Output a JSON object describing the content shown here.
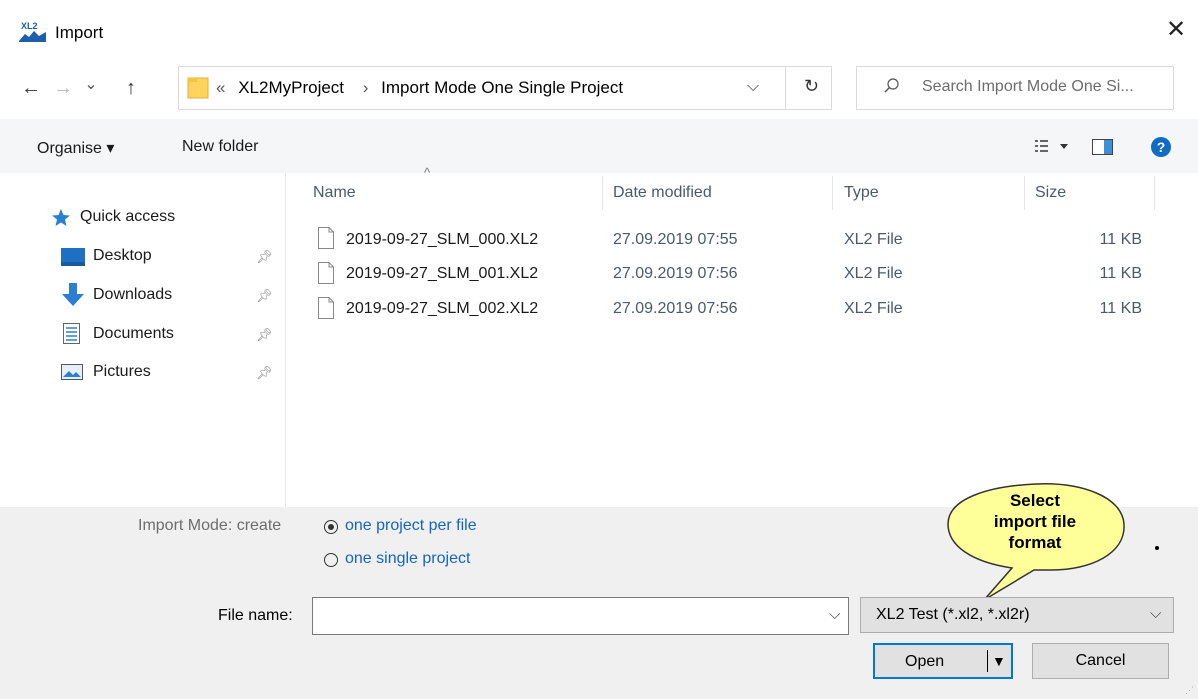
{
  "window": {
    "title": "Import",
    "app_icon_text": "XL2"
  },
  "address": {
    "back": "←",
    "forward": "→",
    "recent": "⌄",
    "up": "↑",
    "crumb_prefix": "«",
    "crumbs": [
      "XL2MyProject",
      "Import Mode One Single Project"
    ],
    "crumb_sep": "›",
    "refresh": "↻"
  },
  "search": {
    "placeholder": "Search Import Mode One Si..."
  },
  "toolbar": {
    "organise": "Organise ▾",
    "new_folder": "New folder"
  },
  "nav": {
    "quick_access": "Quick access",
    "items": [
      {
        "label": "Desktop",
        "icon": "desktop-icon"
      },
      {
        "label": "Downloads",
        "icon": "downloads-icon"
      },
      {
        "label": "Documents",
        "icon": "documents-icon"
      },
      {
        "label": "Pictures",
        "icon": "pictures-icon"
      }
    ]
  },
  "columns": {
    "name": "Name",
    "date": "Date modified",
    "type": "Type",
    "size": "Size"
  },
  "files": [
    {
      "name": "2019-09-27_SLM_000.XL2",
      "date": "27.09.2019 07:55",
      "type": "XL2 File",
      "size": "11 KB"
    },
    {
      "name": "2019-09-27_SLM_001.XL2",
      "date": "27.09.2019 07:56",
      "type": "XL2 File",
      "size": "11 KB"
    },
    {
      "name": "2019-09-27_SLM_002.XL2",
      "date": "27.09.2019 07:56",
      "type": "XL2 File",
      "size": "11 KB"
    }
  ],
  "import_mode": {
    "label": "Import Mode: create",
    "options": [
      "one project per file",
      "one single project"
    ],
    "selected": 0
  },
  "callout": {
    "line1": "Select",
    "line2": "import file",
    "line3": "format"
  },
  "filename": {
    "label": "File name:",
    "value": ""
  },
  "filetype": {
    "value": "XL2 Test (*.xl2, *.xl2r)"
  },
  "buttons": {
    "open": "Open",
    "cancel": "Cancel"
  },
  "colors": {
    "accent": "#0078d7",
    "link_blue": "#1565c0",
    "callout_fill": "#ffff99"
  }
}
